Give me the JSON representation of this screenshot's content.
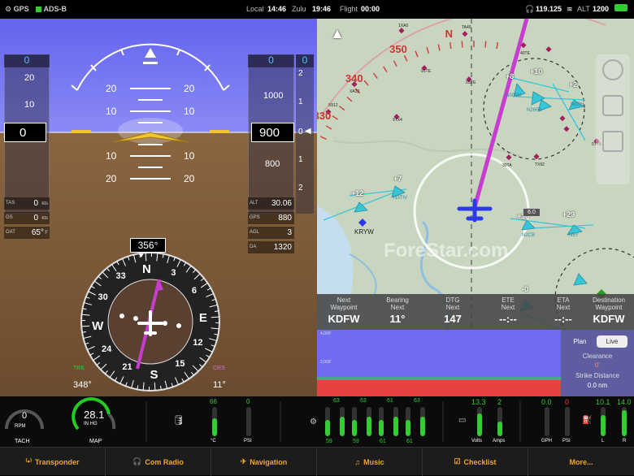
{
  "status": {
    "gps": "GPS",
    "adsb": "ADS-B",
    "local_label": "Local",
    "local": "14:46",
    "zulu_label": "Zulu",
    "zulu": "19:46",
    "flight_label": "Flight",
    "flight": "00:00",
    "com": "119.125",
    "alt_label": "ALT",
    "alt": "1200"
  },
  "pfd": {
    "speed_top": "0",
    "speed_current": "0",
    "speed_ticks": [
      "20",
      "10"
    ],
    "alt_top": "0",
    "alt_current": "900",
    "alt_ticks": [
      "1000",
      "800"
    ],
    "vs_top": "0",
    "vs_ticks": [
      "2",
      "1",
      "0",
      "1",
      "2"
    ],
    "pitch_labels": [
      "20",
      "10",
      "10",
      "20"
    ],
    "tas_label": "TAS",
    "tas": "0",
    "tas_unit": "kts",
    "gs_label": "GS",
    "gs": "0",
    "gs_unit": "kts",
    "oat_label": "OAT",
    "oat": "65°",
    "oat_unit": "F",
    "alt_label": "ALT",
    "alt_val": "30.06",
    "gps_label": "GPS",
    "gps_alt": "880",
    "agl_label": "AGL",
    "agl": "3",
    "da_label": "DA",
    "da": "1320",
    "heading": "356°",
    "compass": [
      "N",
      "3",
      "6",
      "E",
      "12",
      "15",
      "S",
      "21",
      "24",
      "W",
      "30",
      "33"
    ],
    "trk_label": "TRK",
    "trk": "348°",
    "crs_label": "CRS",
    "crs": "11°"
  },
  "map": {
    "compass_labels": [
      "310",
      "320",
      "330",
      "340",
      "350",
      "N"
    ],
    "airports": [
      "1XA0",
      "TA49",
      "91TE",
      "0STE",
      "40TE",
      "9TX4",
      "X512",
      "XA12",
      "0TT5",
      "TX92",
      "30TA",
      "KRYW",
      "KEL"
    ],
    "traffic": [
      "+8",
      "+10",
      "+2",
      "+7",
      "+12",
      "+18",
      "+29",
      "-0"
    ],
    "traffic_ids": [
      "N005M",
      "N26FA",
      "N8CH",
      "N3TIV",
      "N2CB",
      "N5Y"
    ],
    "range_label": "6.0",
    "watermark": "ForeStar.com"
  },
  "navbar": [
    {
      "l1": "Next",
      "l2": "Waypoint",
      "v": "KDFW"
    },
    {
      "l1": "Bearing",
      "l2": "Next",
      "v": "11°"
    },
    {
      "l1": "DTG",
      "l2": "Next",
      "v": "147"
    },
    {
      "l1": "ETE",
      "l2": "Next",
      "v": "--:--"
    },
    {
      "l1": "ETA",
      "l2": "Next",
      "v": "--:--"
    },
    {
      "l1": "Destination",
      "l2": "Waypoint",
      "v": "KDFW"
    }
  ],
  "profile": {
    "alt_top": "4,000'",
    "alt_mid": "2,000'",
    "plan": "Plan",
    "live": "Live",
    "clearance_label": "Clearance",
    "clearance": "0'",
    "strike_label": "Strike Distance",
    "strike": "0.0 nm"
  },
  "engine": {
    "rpm": "0",
    "rpm_unit": "RPM",
    "tach": "TACH",
    "map": "28.1",
    "map_unit": "IN HG",
    "map_label": "MAP",
    "oil_temp": "66",
    "oil_temp_unit": "°C",
    "oil_press": "0",
    "oil_press_unit": "PSI",
    "egt_top": [
      "63",
      "63",
      "61",
      "63"
    ],
    "egt_bot": [
      "59",
      "59",
      "61",
      "61"
    ],
    "volts": "13.3",
    "volts_label": "Volts",
    "amps": "2",
    "amps_label": "Amps",
    "gph": "0.0",
    "gph_label": "GPH",
    "fuel_psi": "0",
    "fuel_psi_label": "PSI",
    "fuel_l": "10.1",
    "fuel_l_label": "L",
    "fuel_r": "14.0",
    "fuel_r_label": "R"
  },
  "tabs": [
    "Transponder",
    "Com Radio",
    "Navigation",
    "Music",
    "Checklist",
    "More..."
  ],
  "colors": {
    "sky": "#6b6bf2",
    "ground": "#7a5a3a",
    "accent": "#f1a52a",
    "route": "#c83cd0",
    "traffic": "#36c6d8"
  }
}
